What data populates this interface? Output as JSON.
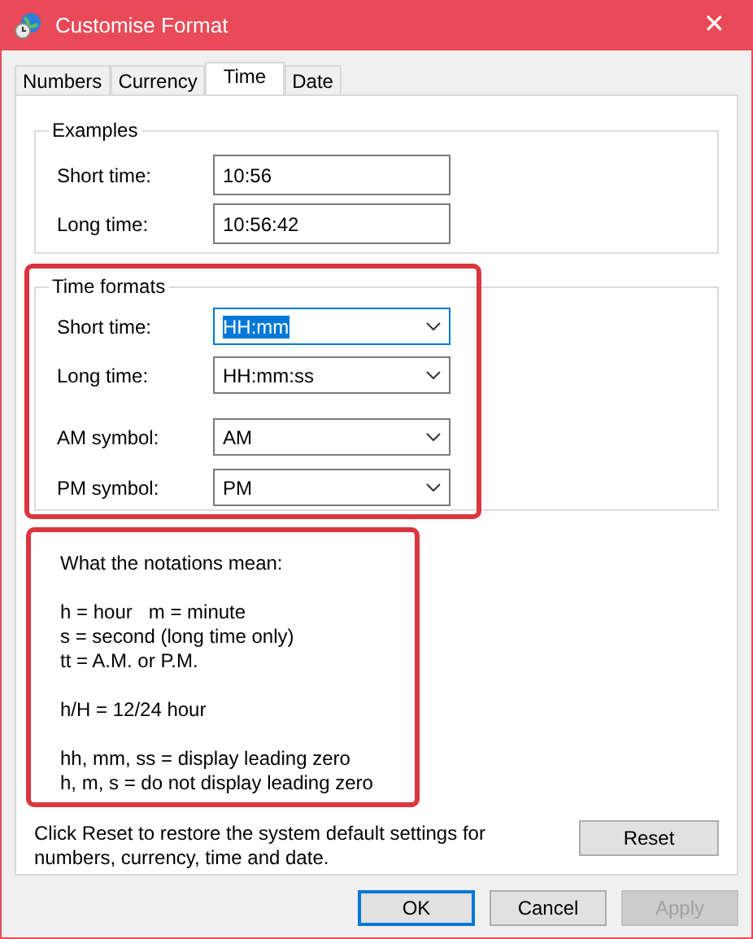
{
  "window": {
    "title": "Customise Format",
    "close": "✕"
  },
  "tabs": [
    {
      "label": "Numbers",
      "selected": false
    },
    {
      "label": "Currency",
      "selected": false
    },
    {
      "label": "Time",
      "selected": true
    },
    {
      "label": "Date",
      "selected": false
    }
  ],
  "examples": {
    "title": "Examples",
    "rows": [
      {
        "label": "Short time:",
        "value": "10:56"
      },
      {
        "label": "Long time:",
        "value": "10:56:42"
      }
    ]
  },
  "time_formats": {
    "title": "Time formats",
    "highlighted": true,
    "rows": [
      {
        "label": "Short time:",
        "value": "HH:mm",
        "focused": true
      },
      {
        "label": "Long time:",
        "value": "HH:mm:ss",
        "focused": false
      },
      {
        "label": "AM symbol:",
        "value": "AM",
        "focused": false
      },
      {
        "label": "PM symbol:",
        "value": "PM",
        "focused": false
      }
    ]
  },
  "notations": {
    "highlighted": true,
    "title": "What the notations mean:",
    "groups": [
      [
        "h = hour   m = minute",
        "s = second (long time only)",
        "tt = A.M. or P.M."
      ],
      [
        "h/H = 12/24 hour"
      ],
      [
        "hh, mm, ss = display leading zero",
        "h, m, s = do not display leading zero"
      ]
    ]
  },
  "reset_note": "Click Reset to restore the system default settings for numbers, currency, time and date.",
  "reset_button": "Reset",
  "buttons": [
    {
      "label": "OK",
      "default": true,
      "disabled": false
    },
    {
      "label": "Cancel",
      "default": false,
      "disabled": false
    },
    {
      "label": "Apply",
      "default": false,
      "disabled": true
    }
  ]
}
